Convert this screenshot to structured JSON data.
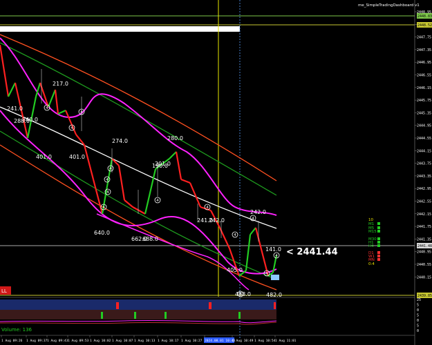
{
  "window": {
    "title": "me_SimpleTradingDashboard v1"
  },
  "price": {
    "current": "2441.44",
    "current_label": "< 2441.44",
    "near_label": "141.0",
    "axis_ticks": [
      "2448.95",
      "2448.55",
      "2447.75",
      "2447.35",
      "2446.95",
      "2446.55",
      "2446.15",
      "2445.75",
      "2445.35",
      "2444.95",
      "2444.55",
      "2444.15",
      "2443.75",
      "2443.35",
      "2442.95",
      "2442.55",
      "2442.15",
      "2441.75",
      "2441.35",
      "2440.95",
      "2440.55",
      "2440.15"
    ],
    "axis_boxes": [
      {
        "label": "2448.83",
        "color": "#7ec84a"
      },
      {
        "label": "2448.52",
        "color": "#c8c832"
      },
      {
        "label": "2441.48",
        "color": "#d8d8d8"
      },
      {
        "label": "2439.85",
        "color": "#c8c832"
      }
    ]
  },
  "chart_labels": [
    {
      "text": "217.0"
    },
    {
      "text": "241.0"
    },
    {
      "text": "288.0"
    },
    {
      "text": "340.0"
    },
    {
      "text": "401.0"
    },
    {
      "text": "401.0"
    },
    {
      "text": "274.0"
    },
    {
      "text": "280.0"
    },
    {
      "text": "201.0"
    },
    {
      "text": "190.0"
    },
    {
      "text": "241.0"
    },
    {
      "text": "242.0"
    },
    {
      "text": "242.0"
    },
    {
      "text": "640.0"
    },
    {
      "text": "662.0"
    },
    {
      "text": "688.0"
    },
    {
      "text": "405.0"
    },
    {
      "text": "488.0"
    },
    {
      "text": "482.0"
    }
  ],
  "wave_markers": [
    "4",
    "4",
    "4",
    "4",
    "4",
    "4",
    "4",
    "4",
    "4",
    "4",
    "4",
    "4",
    "4",
    "4"
  ],
  "timeframes": [
    {
      "label": "10",
      "color": "#e8e000"
    },
    {
      "label": "M1",
      "color": "#22cc22"
    },
    {
      "label": "M5",
      "color": "#22cc22"
    },
    {
      "label": "M15",
      "color": "#22cc22"
    },
    {
      "label": "M30",
      "color": "#22cc22"
    },
    {
      "label": "H1",
      "color": "#22cc22"
    },
    {
      "label": "H4",
      "color": "#22cc22"
    },
    {
      "label": "D1",
      "color": "#ff3030"
    },
    {
      "label": "W1",
      "color": "#ff3030"
    },
    {
      "label": "MN",
      "color": "#ff3030"
    },
    {
      "label": "0:4",
      "color": "#e8e000"
    }
  ],
  "sell_badge": "LL",
  "indicator": {
    "volume_label": "Volume: 136",
    "axis_ticks": [
      "25",
      "5",
      "0",
      "5",
      "0",
      "5",
      "0"
    ]
  },
  "time_axis": [
    "1 Aug 09:26",
    "1 Aug 09:37",
    "1 Aug 09:43",
    "1 Aug 09:53",
    "1 Aug 10:02",
    "1 Aug 10:07",
    "1 Aug 10:13",
    "1 Aug 10:17",
    "1 Aug 10:27",
    "2024.08.01 10:43",
    "1 Aug 10:49",
    "1 Aug 10:54",
    "1 Aug 11:01"
  ],
  "colors": {
    "up": "#22cc22",
    "down": "#ff2020",
    "magenta": "#ff22ff",
    "ma_white": "#ffffff",
    "ma_orange": "#ff5020",
    "ma_green": "#1e9a1e",
    "crosshair": "#e8e800",
    "grid": "#3a3a3a"
  }
}
